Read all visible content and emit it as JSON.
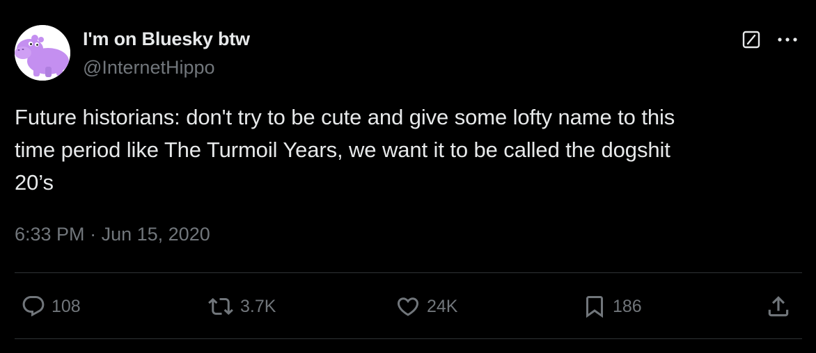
{
  "author": {
    "display_name": "I'm on Bluesky btw",
    "handle": "@InternetHippo",
    "avatar_icon": "purple-hippo-avatar"
  },
  "header_actions": {
    "grok_icon": "grok-icon",
    "more_icon": "more-options-icon"
  },
  "tweet": {
    "text": "Future historians: don't try to be cute and give some lofty name to this\ntime period like The Turmoil Years, we want it to be called the dogshit\n20’s",
    "time": "6:33 PM",
    "separator": "·",
    "date": "Jun 15, 2020"
  },
  "actions": {
    "replies": "108",
    "retweets": "3.7K",
    "likes": "24K",
    "bookmarks": "186"
  },
  "colors": {
    "background": "#000000",
    "primary_text": "#e7e9ea",
    "secondary_text": "#71767b",
    "divider": "#2f3336",
    "avatar_accent": "#c48ff0"
  }
}
